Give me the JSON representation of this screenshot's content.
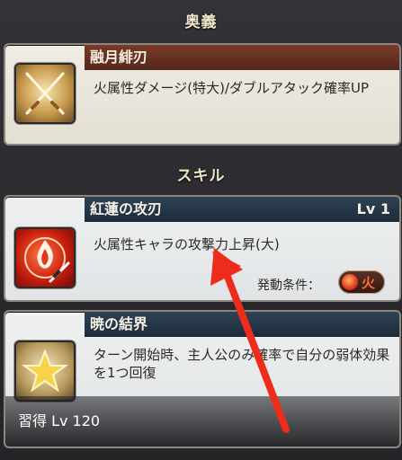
{
  "sections": {
    "ougi_header": "奥義",
    "skill_header": "スキル"
  },
  "ougi": {
    "name": "融月緋刃",
    "description": "火属性ダメージ(特大)/ダブルアタック確率UP",
    "icon": "crossed-swords-icon"
  },
  "skills": [
    {
      "name": "紅蓮の攻刃",
      "level": "Lv 1",
      "description": "火属性キャラの攻撃力上昇(大)",
      "icon": "flame-sword-icon",
      "condition_label": "発動条件：",
      "condition_element": "火",
      "element_color": "#e2381c"
    },
    {
      "name": "暁の結界",
      "description": "ターン開始時、主人公のみ確率で自分の弱体効果を1つ回復",
      "icon": "star-icon",
      "learn_label": "習得 Lv 120"
    }
  ],
  "colors": {
    "ougi_title_bar": "#7a3a29",
    "skill_title_bar": "#2f4356",
    "annotation_arrow": "#ee2c1c"
  }
}
